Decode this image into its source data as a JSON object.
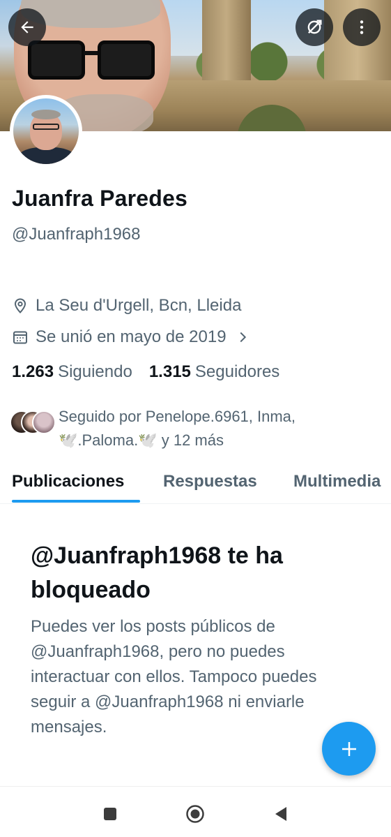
{
  "profile": {
    "name": "Juanfra Paredes",
    "handle": "@Juanfraph1968",
    "location": "La Seu d'Urgell, Bcn, Lleida",
    "joined": "Se unió en mayo de 2019",
    "following_count": "1.263",
    "following_label": "Siguiendo",
    "followers_count": "1.315",
    "followers_label": "Seguidores",
    "followed_by_line1": "Seguido por Penelope.6961, Inma,",
    "followed_by_line2": "🕊️.Paloma.🕊️ y 12 más"
  },
  "header_buttons": {
    "back_icon": "arrow-left-icon",
    "translate_icon": "no-translate-icon",
    "more_icon": "more-vertical-icon"
  },
  "tabs": [
    {
      "label": "Publicaciones",
      "active": true
    },
    {
      "label": "Respuestas",
      "active": false
    },
    {
      "label": "Multimedia",
      "active": false
    }
  ],
  "blocked": {
    "title": "@Juanfraph1968 te ha bloqueado",
    "body": "Puedes ver los posts públicos de @Juanfraph1968, pero no puedes interactuar con ellos. Tampoco puedes seguir a @Juanfraph1968 ni enviarle mensajes."
  },
  "fab": {
    "icon": "plus-icon"
  },
  "colors": {
    "accent": "#1d9bf0",
    "text_primary": "#0f1419",
    "text_secondary": "#536471"
  }
}
